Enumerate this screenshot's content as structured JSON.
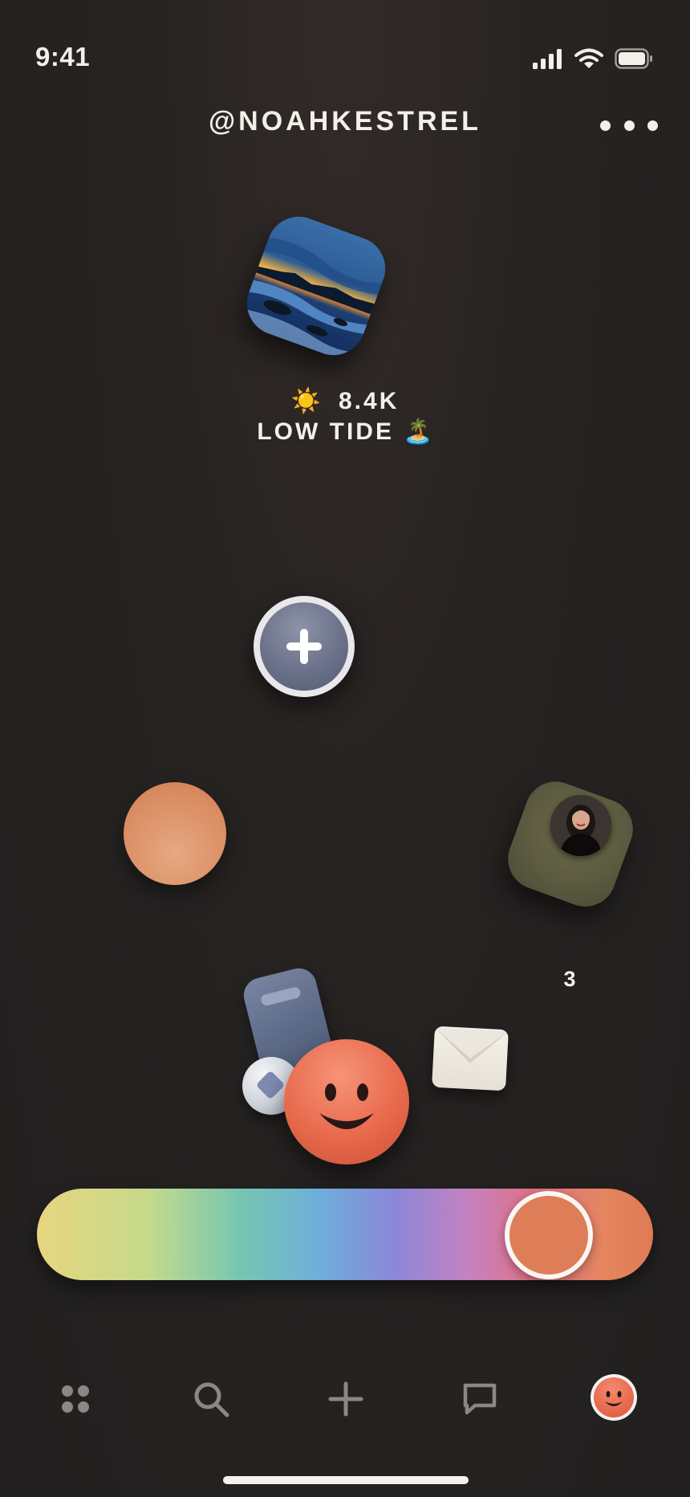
{
  "status_bar": {
    "time": "9:41",
    "icons": [
      "cellular-signal-icon",
      "wifi-icon",
      "battery-icon"
    ]
  },
  "header": {
    "username": "@NOAHKESTREL",
    "more_icon": "ellipsis-icon"
  },
  "profile": {
    "photo": "sunset-beach-photo",
    "stat_icon": "☀️",
    "stat_value": "8.4K",
    "mood_label": "LOW TIDE",
    "mood_emoji": "🏝️"
  },
  "friend": {
    "count": "3"
  },
  "mood_slider": {
    "value": 0.89,
    "thumb_color": "#dd7e58"
  },
  "tab_bar": {
    "tabs": [
      {
        "name": "home",
        "icon": "grid-dots-icon",
        "active": false
      },
      {
        "name": "search",
        "icon": "search-icon",
        "active": false
      },
      {
        "name": "create",
        "icon": "plus-icon",
        "active": false
      },
      {
        "name": "messages",
        "icon": "chat-bubble-icon",
        "active": false
      },
      {
        "name": "profile",
        "icon": "smiley-avatar-icon",
        "active": true
      }
    ]
  },
  "colors": {
    "background": "#252221",
    "text": "#f3efe9",
    "icon_inactive": "#8a8784",
    "accent": "#e8694c"
  }
}
